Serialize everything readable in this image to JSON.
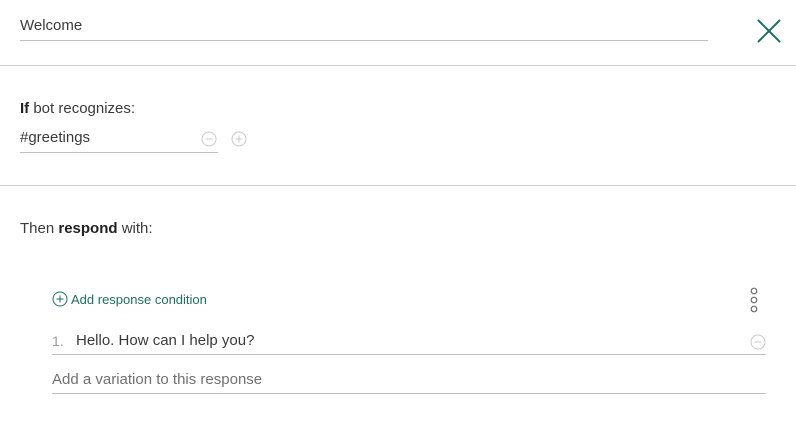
{
  "node": {
    "name": "Welcome"
  },
  "condition": {
    "if_bold": "If",
    "if_rest": " bot recognizes:",
    "value": "#greetings"
  },
  "response": {
    "then_pre": "Then ",
    "then_bold": "respond",
    "then_post": " with:",
    "add_condition_label": "Add response condition",
    "items": [
      {
        "number": "1.",
        "text": "Hello. How can I help you?"
      }
    ],
    "variation_placeholder": "Add a variation to this response"
  },
  "icons": {
    "close": "close-icon",
    "remove": "minus-circle-icon",
    "add": "plus-circle-icon",
    "more": "vertical-dots-icon"
  },
  "colors": {
    "accent": "#1f6e63",
    "divider": "#d0d0d0",
    "muted": "#c8c8c8"
  }
}
